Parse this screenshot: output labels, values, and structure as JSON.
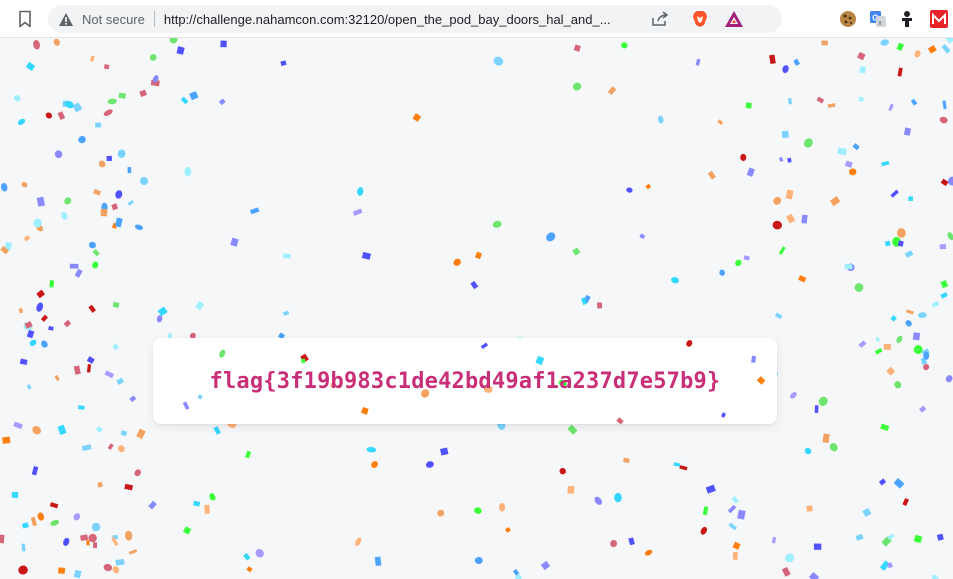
{
  "browser": {
    "security_label": "Not secure",
    "url": "http://challenge.nahamcon.com:32120/open_the_pod_bay_doors_hal_and_...",
    "icons": [
      "bookmark-icon",
      "warning-icon",
      "share-icon",
      "brave-shields-icon",
      "brave-rewards-icon",
      "cookie-extension-icon",
      "translate-extension-icon",
      "puzzle-extension-icon",
      "m-extension-icon"
    ],
    "colors": {
      "brave": "#fb542b",
      "rewards": "#a1207c",
      "m_ext": "#e8232a"
    }
  },
  "page": {
    "flag": "flag{3f19b983c1de42bd49af1a237d7e57b9}",
    "flag_color": "#c92f78",
    "confetti_colors": [
      "#f4a261",
      "#ff7f0e",
      "#33d7ff",
      "#4ba3ff",
      "#5151ff",
      "#8a8aff",
      "#a79bff",
      "#3cff3c",
      "#6ee56e",
      "#c91717",
      "#d6657a",
      "#ffb27a",
      "#7ad3ff",
      "#9ff0ff"
    ]
  }
}
